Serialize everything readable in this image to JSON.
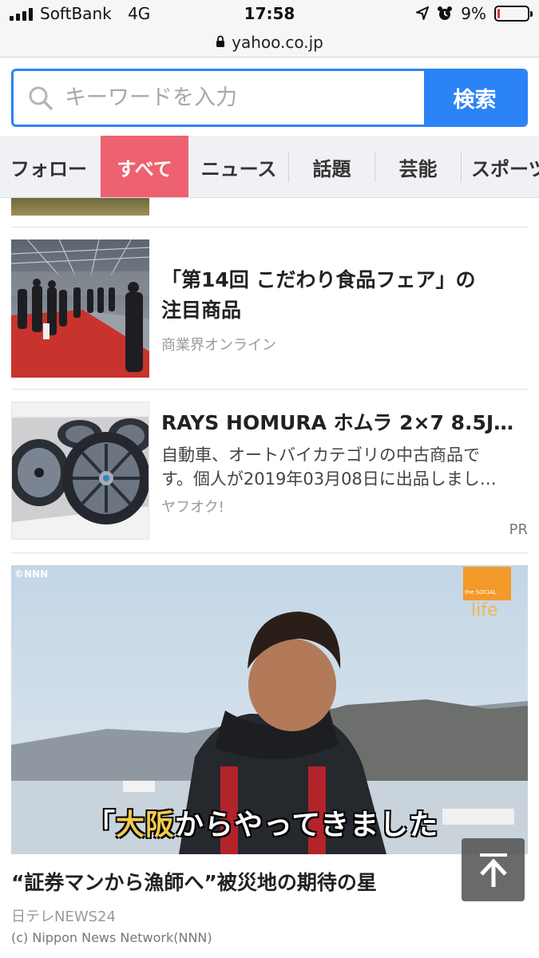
{
  "status_bar": {
    "carrier": "SoftBank",
    "network": "4G",
    "time": "17:58",
    "battery": "9%",
    "battery_level": 0.09,
    "icons": [
      "signal-icon",
      "location-icon",
      "alarm-icon",
      "battery-icon"
    ]
  },
  "browser": {
    "url": "yahoo.co.jp",
    "lock_icon": "lock-icon"
  },
  "search": {
    "placeholder": "キーワードを入力",
    "button": "検索",
    "icon": "search-icon",
    "accent": "#2b83f6"
  },
  "tabs": [
    {
      "label": "フォロー",
      "active": false
    },
    {
      "label": "すべて",
      "active": true
    },
    {
      "label": "ニュース",
      "active": false
    },
    {
      "label": "話題",
      "active": false
    },
    {
      "label": "芸能",
      "active": false
    },
    {
      "label": "スポーツ",
      "active": false
    }
  ],
  "tab_active_color": "#ee6170",
  "articles": [
    {
      "title_line1": "「第14回 こだわり食品フェア」の",
      "title_line2": "注目商品",
      "source": "商業界オンライン"
    },
    {
      "title": "RAYS HOMURA ホムラ 2×7 8.5J…",
      "desc_line1": "自動車、オートバイカテゴリの中古商品で",
      "desc_line2": "す。個人が2019年03月08日に出品しまし…",
      "source": "ヤフオク!",
      "badge": "PR"
    }
  ],
  "video": {
    "watermark": "©NNN",
    "logo_small": "the SOCIAL",
    "logo_text": "life",
    "caption_highlight": "大阪",
    "caption_rest": "からやってきました",
    "caption_open": "「",
    "title": "“証券マンから漁師へ”被災地の期待の星",
    "source": "日テレNEWS24",
    "credit": "(c) Nippon News Network(NNN)"
  },
  "scroll_top_icon": "arrow-up-icon"
}
